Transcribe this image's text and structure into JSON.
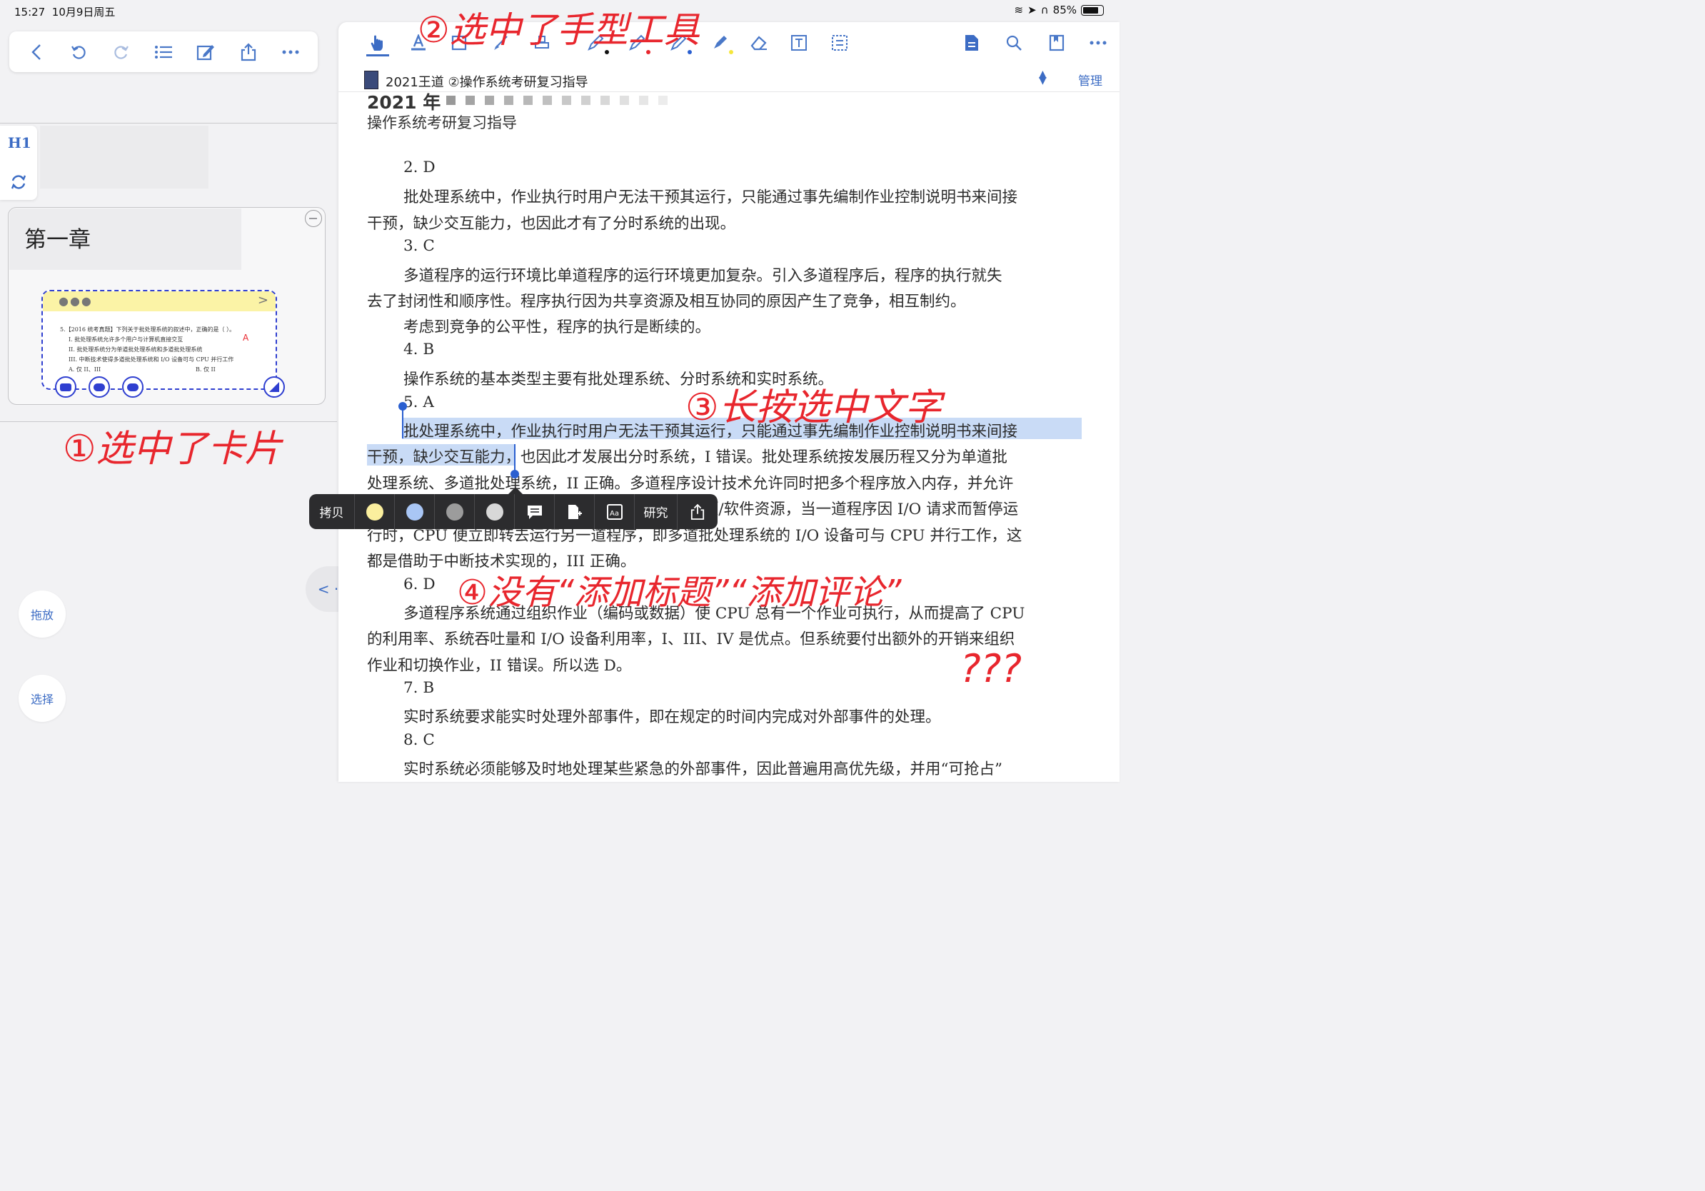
{
  "status_bar": {
    "time": "15:27",
    "date": "10月9日周五",
    "battery": "85%"
  },
  "left_toolbar": {
    "icons": [
      "back-icon",
      "undo-icon",
      "redo-icon",
      "list-icon",
      "edit-icon",
      "share-icon",
      "more-icon"
    ]
  },
  "side_tool": {
    "heading_label": "H1"
  },
  "card": {
    "title": "第一章",
    "snippet_lines": [
      "5.【2016 统考真题】下列关于批处理系统的叙述中，正确的是（  ）。",
      "I.  批处理系统允许多个用户与计算机直接交互",
      "II.  批处理系统分为单道批处理系统和多道批处理系统",
      "III.  中断技术使得多道批处理系统和 I/O 设备可与 CPU 并行工作",
      "A.  仅 II、III",
      "B.  仅 II"
    ],
    "snippet_mark": "A"
  },
  "left_buttons": {
    "drag": "拖放",
    "select": "选择",
    "collapse": "< · >"
  },
  "document": {
    "tab_title": "2021王道 ②操作系统考研复习指导",
    "manage": "管理",
    "book_year": "2021 年",
    "book_subtitle": "操作系统考研复习指导",
    "lines": [
      "2.  D",
      "批处理系统中，作业执行时用户无法干预其运行，只能通过事先编制作业控制说明书来间接",
      "干预，缺少交互能力，也因此才有了分时系统的出现。",
      "3.  C",
      "多道程序的运行环境比单道程序的运行环境更加复杂。引入多道程序后，程序的执行就失",
      "去了封闭性和顺序性。程序执行因为共享资源及相互协同的原因产生了竞争，相互制约。",
      "考虑到竞争的公平性，程序的执行是断续的。",
      "4.  B",
      "操作系统的基本类型主要有批处理系统、分时系统和实时系统。",
      "5.  A",
      "批处理系统中，作业执行时用户无法干预其运行，只能通过事先编制作业控制说明书来间接",
      "干预，缺少交互能力，也因此才发展出分时系统，I 错误。批处理系统按发展历程又分为单道批",
      "处理系统、多道批处理系统，II 正确。多道程序设计技术允许同时把多个程序放入内存，并允许",
      "它们交替在 CPU 中运行，它们共享系统中的各种硬/软件资源，当一道程序因 I/O 请求而暂停运",
      "行时，CPU 便立即转去运行另一道程序，即多道批处理系统的 I/O 设备可与 CPU 并行工作，这",
      "都是借助于中断技术实现的，III 正确。",
      "6.  D",
      "多道程序系统通过组织作业（编码或数据）使 CPU 总有一个作业可执行，从而提高了 CPU",
      "的利用率、系统吞吐量和 I/O 设备利用率，I、III、IV 是优点。但系统要付出额外的开销来组织",
      "作业和切换作业，II 错误。所以选 D。",
      "7.  B",
      "实时系统要求能实时处理外部事件，即在规定的时间内完成对外部事件的处理。",
      "8.  C",
      "实时系统必须能够及时地处理某些紧急的外部事件，因此普遍用高优先级，并用“可抢占”"
    ]
  },
  "context_menu": {
    "copy": "拷贝",
    "research": "研究",
    "swatches": [
      "#fbef9e",
      "#a9c6f5",
      "#9c9c9c",
      "#d8d8d8"
    ]
  },
  "annotations": {
    "step1": "①选中了卡片",
    "step2": "②选中了手型工具",
    "step3": "③长按选中文字",
    "step4": "④没有“添加标题”“添加评论”",
    "question": "???"
  },
  "colors": {
    "accent": "#3c6cc4",
    "annotation": "#e8262d",
    "highlight": "#c9dbf6"
  }
}
